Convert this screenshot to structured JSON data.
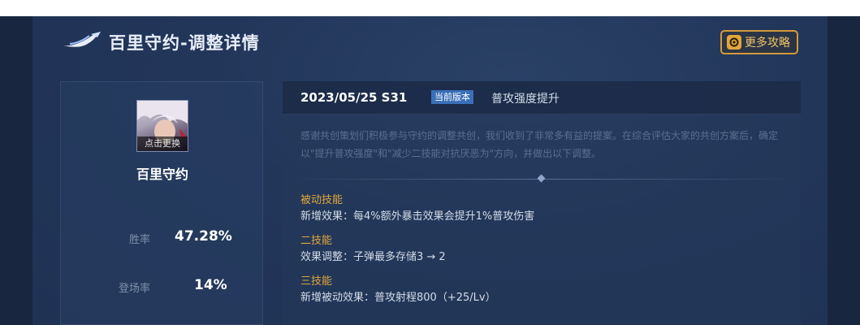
{
  "header": {
    "title": "百里守约-调整详情",
    "more_button": "更多攻略"
  },
  "hero": {
    "avatar_overlay": "点击更换",
    "name": "百里守约",
    "stats": [
      {
        "label": "胜率",
        "value": "47.28%"
      },
      {
        "label": "登场率",
        "value": "14%"
      }
    ]
  },
  "change": {
    "date": "2023/05/25  S31",
    "badge": "当前版本",
    "title": "普攻强度提升",
    "description": "感谢共创策划们积极参与守约的调整共创，我们收到了非常多有益的提案。在综合评估大家的共创方案后，确定以\"提升普攻强度\"和\"减少二技能对抗厌恶为\"方向，并做出以下调整。",
    "sections": [
      {
        "title": "被动技能",
        "body": "新增效果：每4%额外暴击效果会提升1%普攻伤害"
      },
      {
        "title": "二技能",
        "body": "效果调整：子弹最多存储3 → 2"
      },
      {
        "title": "三技能",
        "body": "新增被动效果：普攻射程800（+25/Lv）"
      }
    ]
  },
  "colors": {
    "accent_gold": "#e2a63b",
    "badge_blue": "#3a6fb8",
    "panel_bg": "#22365a"
  },
  "icons": [
    "logo-swoosh-icon",
    "strategy-icon"
  ]
}
